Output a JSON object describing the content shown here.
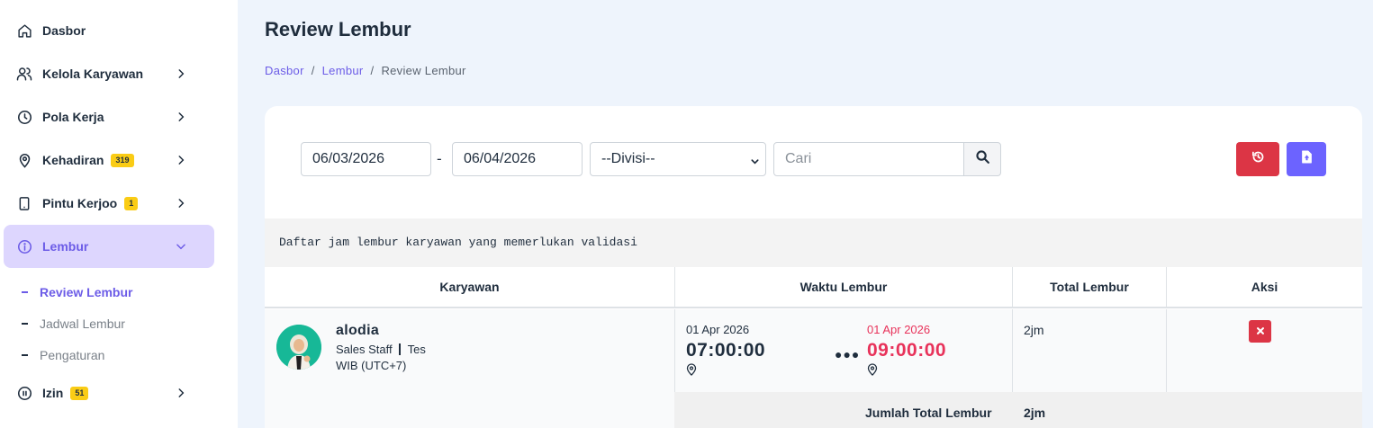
{
  "sidebar": {
    "items": [
      {
        "label": "Dasbor",
        "icon": "home-icon"
      },
      {
        "label": "Kelola Karyawan",
        "icon": "users-icon"
      },
      {
        "label": "Pola Kerja",
        "icon": "clock-icon"
      },
      {
        "label": "Kehadiran",
        "icon": "map-pin-icon",
        "badge": "319"
      },
      {
        "label": "Pintu Kerjoo",
        "icon": "tablet-icon",
        "badge": "1"
      },
      {
        "label": "Lembur",
        "icon": "info-icon"
      },
      {
        "label": "Izin",
        "icon": "pause-circle-icon",
        "badge": "51"
      }
    ],
    "lembur_sub": [
      {
        "label": "Review Lembur"
      },
      {
        "label": "Jadwal Lembur"
      },
      {
        "label": "Pengaturan"
      }
    ]
  },
  "header": {
    "title": "Review Lembur",
    "breadcrumb": [
      "Dasbor",
      "Lembur",
      "Review Lembur"
    ],
    "breadcrumb_sep": "/"
  },
  "filters": {
    "date_from": "06/03/2026",
    "date_sep": "-",
    "date_to": "06/04/2026",
    "division_selected": "--Divisi--",
    "search_placeholder": "Cari"
  },
  "description": "Daftar jam lembur karyawan yang memerlukan validasi",
  "table": {
    "columns": [
      "Karyawan",
      "Waktu Lembur",
      "Total Lembur",
      "Aksi"
    ],
    "rows": [
      {
        "name": "alodia",
        "position": "Sales Staff",
        "division": "Tes",
        "timezone": "WIB (UTC+7)",
        "start_date": "01 Apr 2026",
        "start_time": "07:00:00",
        "end_date": "01 Apr 2026",
        "end_time": "09:00:00",
        "total": "2jm"
      }
    ],
    "footer_label": "Jumlah Total Lembur",
    "footer_total": "2jm"
  },
  "colors": {
    "accent": "#6c5ce7",
    "danger": "#dc3545",
    "end_time": "#e8325a",
    "badge": "#facc15",
    "active_nav_bg": "#ddd6fe"
  }
}
